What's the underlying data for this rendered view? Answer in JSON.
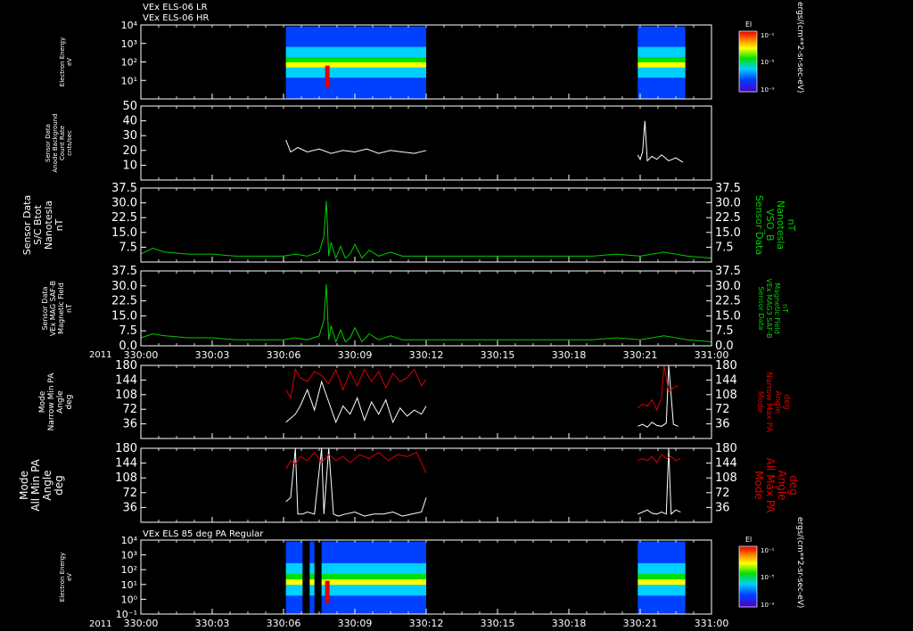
{
  "colors": {
    "background": "#000000",
    "axes": "#ffffff",
    "trace_white": "#ffffff",
    "trace_green": "#00cc00",
    "trace_red": "#dd0000",
    "label_green": "#00cc00",
    "label_red": "#dd0000"
  },
  "header": {
    "line1": "VEx ELS-06 LR",
    "line2": "VEx ELS-06 HR",
    "panel7_title": "VEx ELS 85 deg PA Regular"
  },
  "time_axis": {
    "year": "2011",
    "ticks": [
      "330:00",
      "330:03",
      "330:06",
      "330:09",
      "330:12",
      "330:15",
      "330:18",
      "330:21",
      "331:00"
    ]
  },
  "colorbar": {
    "title": "El",
    "ticks": [
      "10⁻¹",
      "10⁻⁵",
      "10⁻⁹"
    ],
    "units": "ergs/(cm**2-sr-sec-eV)"
  },
  "chart_data": [
    {
      "type": "heatmap",
      "panel": "electron-energy-lr-hr",
      "ylabel": [
        "Electron Energy",
        "eV"
      ],
      "yscale": "log",
      "ylim": [
        1,
        10000
      ],
      "yticks": [
        "10⁴",
        "10³",
        "10²",
        "10¹"
      ],
      "coverage_hours": [
        [
          6.1,
          12.0
        ],
        [
          20.9,
          22.9
        ]
      ]
    },
    {
      "type": "line",
      "panel": "anode-background",
      "ylabel": [
        "Sensor Data",
        "Anode Background",
        "Count Rate",
        "cnts/sec"
      ],
      "ylim": [
        0,
        50
      ],
      "yticks": [
        "50",
        "40",
        "30",
        "20",
        "10"
      ],
      "series": [
        {
          "color": "#ffffff",
          "x": [
            6.1,
            6.3,
            6.6,
            7.0,
            7.5,
            8.0,
            8.5,
            9.0,
            9.5,
            10.0,
            10.5,
            11.0,
            11.5,
            12.0
          ],
          "values": [
            27,
            19,
            22,
            19,
            21,
            18,
            20,
            19,
            21,
            18,
            20,
            19,
            18,
            20
          ]
        },
        {
          "color": "#ffffff",
          "x": [
            20.9,
            21.0,
            21.1,
            21.2,
            21.3,
            21.5,
            21.7,
            21.9,
            22.2,
            22.5,
            22.8
          ],
          "values": [
            17,
            14,
            19,
            40,
            13,
            16,
            14,
            17,
            13,
            15,
            12
          ]
        }
      ]
    },
    {
      "type": "line",
      "panel": "b-vso",
      "ylabel": [
        "Sensor Data",
        "S/C Btot",
        "Nanotesla",
        "nT"
      ],
      "ylabel_right": [
        "Sensor Data",
        "VSO_B",
        "Nanotesla",
        "nT"
      ],
      "ylim": [
        0,
        37.5
      ],
      "yticks": [
        "37.5",
        "30.0",
        "22.5",
        "15.0",
        "7.5"
      ],
      "series": [
        {
          "color": "#00cc00",
          "x": [
            0,
            0.5,
            1,
            2,
            3,
            4,
            5,
            6,
            6.5,
            7,
            7.5,
            7.7,
            7.8,
            7.9,
            8.0,
            8.2,
            8.4,
            8.6,
            8.8,
            9.0,
            9.3,
            9.6,
            10.0,
            10.5,
            11,
            12,
            13,
            14,
            15,
            16,
            17,
            18,
            19,
            20,
            21,
            22,
            23,
            24
          ],
          "values": [
            4,
            7,
            5,
            4,
            4,
            3,
            3,
            3,
            4,
            3,
            5,
            13,
            31,
            3,
            10,
            2,
            8,
            2,
            4,
            9,
            2,
            6,
            3,
            5,
            3,
            3,
            3,
            3,
            3,
            3,
            3,
            3,
            3,
            4,
            3,
            5,
            3,
            2
          ]
        }
      ]
    },
    {
      "type": "line",
      "panel": "b-saf",
      "ylabel": [
        "Sensor Data",
        "VEx MAG SAF-B",
        "Magnetic Field",
        "nT"
      ],
      "ylabel_right": [
        "Sensor Data",
        "VEx MAG3 SAF-B",
        "Magnetic Field",
        "nT"
      ],
      "ylim": [
        0,
        37.5
      ],
      "yticks": [
        "37.5",
        "30.0",
        "22.5",
        "15.0",
        "7.5",
        "0.0"
      ],
      "series": [
        {
          "color": "#00cc00",
          "x": [
            0,
            0.5,
            1,
            2,
            3,
            4,
            5,
            6,
            6.5,
            7,
            7.5,
            7.7,
            7.8,
            7.9,
            8.0,
            8.2,
            8.4,
            8.6,
            8.8,
            9.0,
            9.3,
            9.6,
            10.0,
            10.5,
            11,
            12,
            13,
            14,
            15,
            16,
            17,
            18,
            19,
            20,
            21,
            22,
            23,
            24
          ],
          "values": [
            4,
            6,
            5,
            4,
            4,
            3,
            3,
            3,
            4,
            3,
            5,
            13,
            31,
            3,
            10,
            2,
            8,
            2,
            4,
            9,
            2,
            6,
            3,
            5,
            3,
            3,
            3,
            3,
            3,
            3,
            3,
            3,
            3,
            4,
            3,
            5,
            3,
            2
          ]
        }
      ]
    },
    {
      "type": "line",
      "panel": "narrow-pa",
      "ylabel": [
        "Mode",
        "Narrow Min PA",
        "Angle",
        "deg"
      ],
      "ylabel_right": [
        "Mode",
        "Narrow Max PA",
        "Angle",
        "deg"
      ],
      "ylim": [
        0,
        180
      ],
      "yticks": [
        "180",
        "144",
        "108",
        "72",
        "36"
      ],
      "series": [
        {
          "color": "#ffffff",
          "x": [
            6.1,
            6.3,
            6.5,
            6.7,
            7.0,
            7.3,
            7.6,
            7.9,
            8.2,
            8.5,
            8.8,
            9.1,
            9.4,
            9.7,
            10.0,
            10.3,
            10.6,
            10.9,
            11.2,
            11.5,
            11.8,
            12.0
          ],
          "values": [
            40,
            50,
            60,
            80,
            120,
            70,
            140,
            90,
            40,
            80,
            60,
            100,
            45,
            90,
            60,
            95,
            40,
            75,
            55,
            70,
            60,
            80
          ]
        },
        {
          "color": "#dd0000",
          "x": [
            6.1,
            6.3,
            6.5,
            6.7,
            7.0,
            7.3,
            7.6,
            7.9,
            8.2,
            8.5,
            8.8,
            9.1,
            9.4,
            9.7,
            10.0,
            10.3,
            10.6,
            10.9,
            11.2,
            11.5,
            11.8,
            12.0
          ],
          "values": [
            120,
            100,
            170,
            150,
            140,
            165,
            155,
            135,
            170,
            120,
            165,
            130,
            170,
            140,
            165,
            125,
            160,
            140,
            150,
            170,
            130,
            145
          ]
        },
        {
          "color": "#ffffff",
          "x": [
            20.9,
            21.1,
            21.3,
            21.5,
            21.7,
            21.9,
            22.1,
            22.2,
            22.4,
            22.6
          ],
          "values": [
            30,
            35,
            28,
            40,
            32,
            30,
            38,
            180,
            35,
            30
          ]
        },
        {
          "color": "#dd0000",
          "x": [
            20.9,
            21.1,
            21.3,
            21.5,
            21.7,
            21.9,
            22.0,
            22.2,
            22.4,
            22.6
          ],
          "values": [
            75,
            85,
            80,
            95,
            70,
            100,
            180,
            115,
            125,
            130
          ]
        }
      ]
    },
    {
      "type": "line",
      "panel": "all-pa",
      "ylabel": [
        "Mode",
        "All Min PA",
        "Angle",
        "deg"
      ],
      "ylabel_right": [
        "Mode",
        "All Max PA",
        "Angle",
        "deg"
      ],
      "ylim": [
        0,
        180
      ],
      "yticks": [
        "180",
        "144",
        "108",
        "72",
        "36"
      ],
      "series": [
        {
          "color": "#ffffff",
          "x": [
            6.1,
            6.3,
            6.5,
            6.6,
            6.8,
            7.0,
            7.3,
            7.6,
            7.7,
            7.9,
            8.1,
            8.3,
            8.6,
            9.0,
            9.4,
            9.8,
            10.2,
            10.6,
            11.0,
            11.4,
            11.8,
            12.0
          ],
          "values": [
            50,
            60,
            180,
            20,
            20,
            25,
            20,
            180,
            20,
            180,
            20,
            15,
            20,
            25,
            15,
            20,
            20,
            25,
            15,
            20,
            25,
            60
          ]
        },
        {
          "color": "#dd0000",
          "x": [
            6.1,
            6.3,
            6.5,
            6.7,
            7.0,
            7.3,
            7.6,
            7.9,
            8.2,
            8.5,
            8.8,
            9.2,
            9.6,
            10.0,
            10.4,
            10.8,
            11.2,
            11.6,
            12.0
          ],
          "values": [
            130,
            150,
            140,
            160,
            150,
            170,
            145,
            165,
            150,
            160,
            145,
            165,
            155,
            170,
            150,
            165,
            160,
            170,
            120
          ]
        },
        {
          "color": "#ffffff",
          "x": [
            20.9,
            21.1,
            21.3,
            21.5,
            21.7,
            21.9,
            22.1,
            22.2,
            22.3,
            22.5,
            22.7
          ],
          "values": [
            20,
            25,
            30,
            22,
            20,
            25,
            20,
            180,
            20,
            30,
            25
          ]
        },
        {
          "color": "#dd0000",
          "x": [
            20.9,
            21.1,
            21.3,
            21.5,
            21.7,
            21.9,
            22.1,
            22.3,
            22.5,
            22.7
          ],
          "values": [
            150,
            155,
            150,
            160,
            145,
            165,
            155,
            160,
            150,
            155
          ]
        }
      ]
    },
    {
      "type": "heatmap",
      "panel": "electron-energy-85pa",
      "ylabel": [
        "Electron Energy",
        "eV"
      ],
      "yscale": "log",
      "ylim": [
        0.1,
        10000
      ],
      "yticks": [
        "10⁴",
        "10³",
        "10²",
        "10¹",
        "10⁰",
        "10⁻¹"
      ],
      "coverage_hours": [
        [
          6.1,
          6.8
        ],
        [
          7.1,
          7.3
        ],
        [
          7.6,
          12.0
        ],
        [
          20.9,
          22.9
        ]
      ]
    }
  ]
}
